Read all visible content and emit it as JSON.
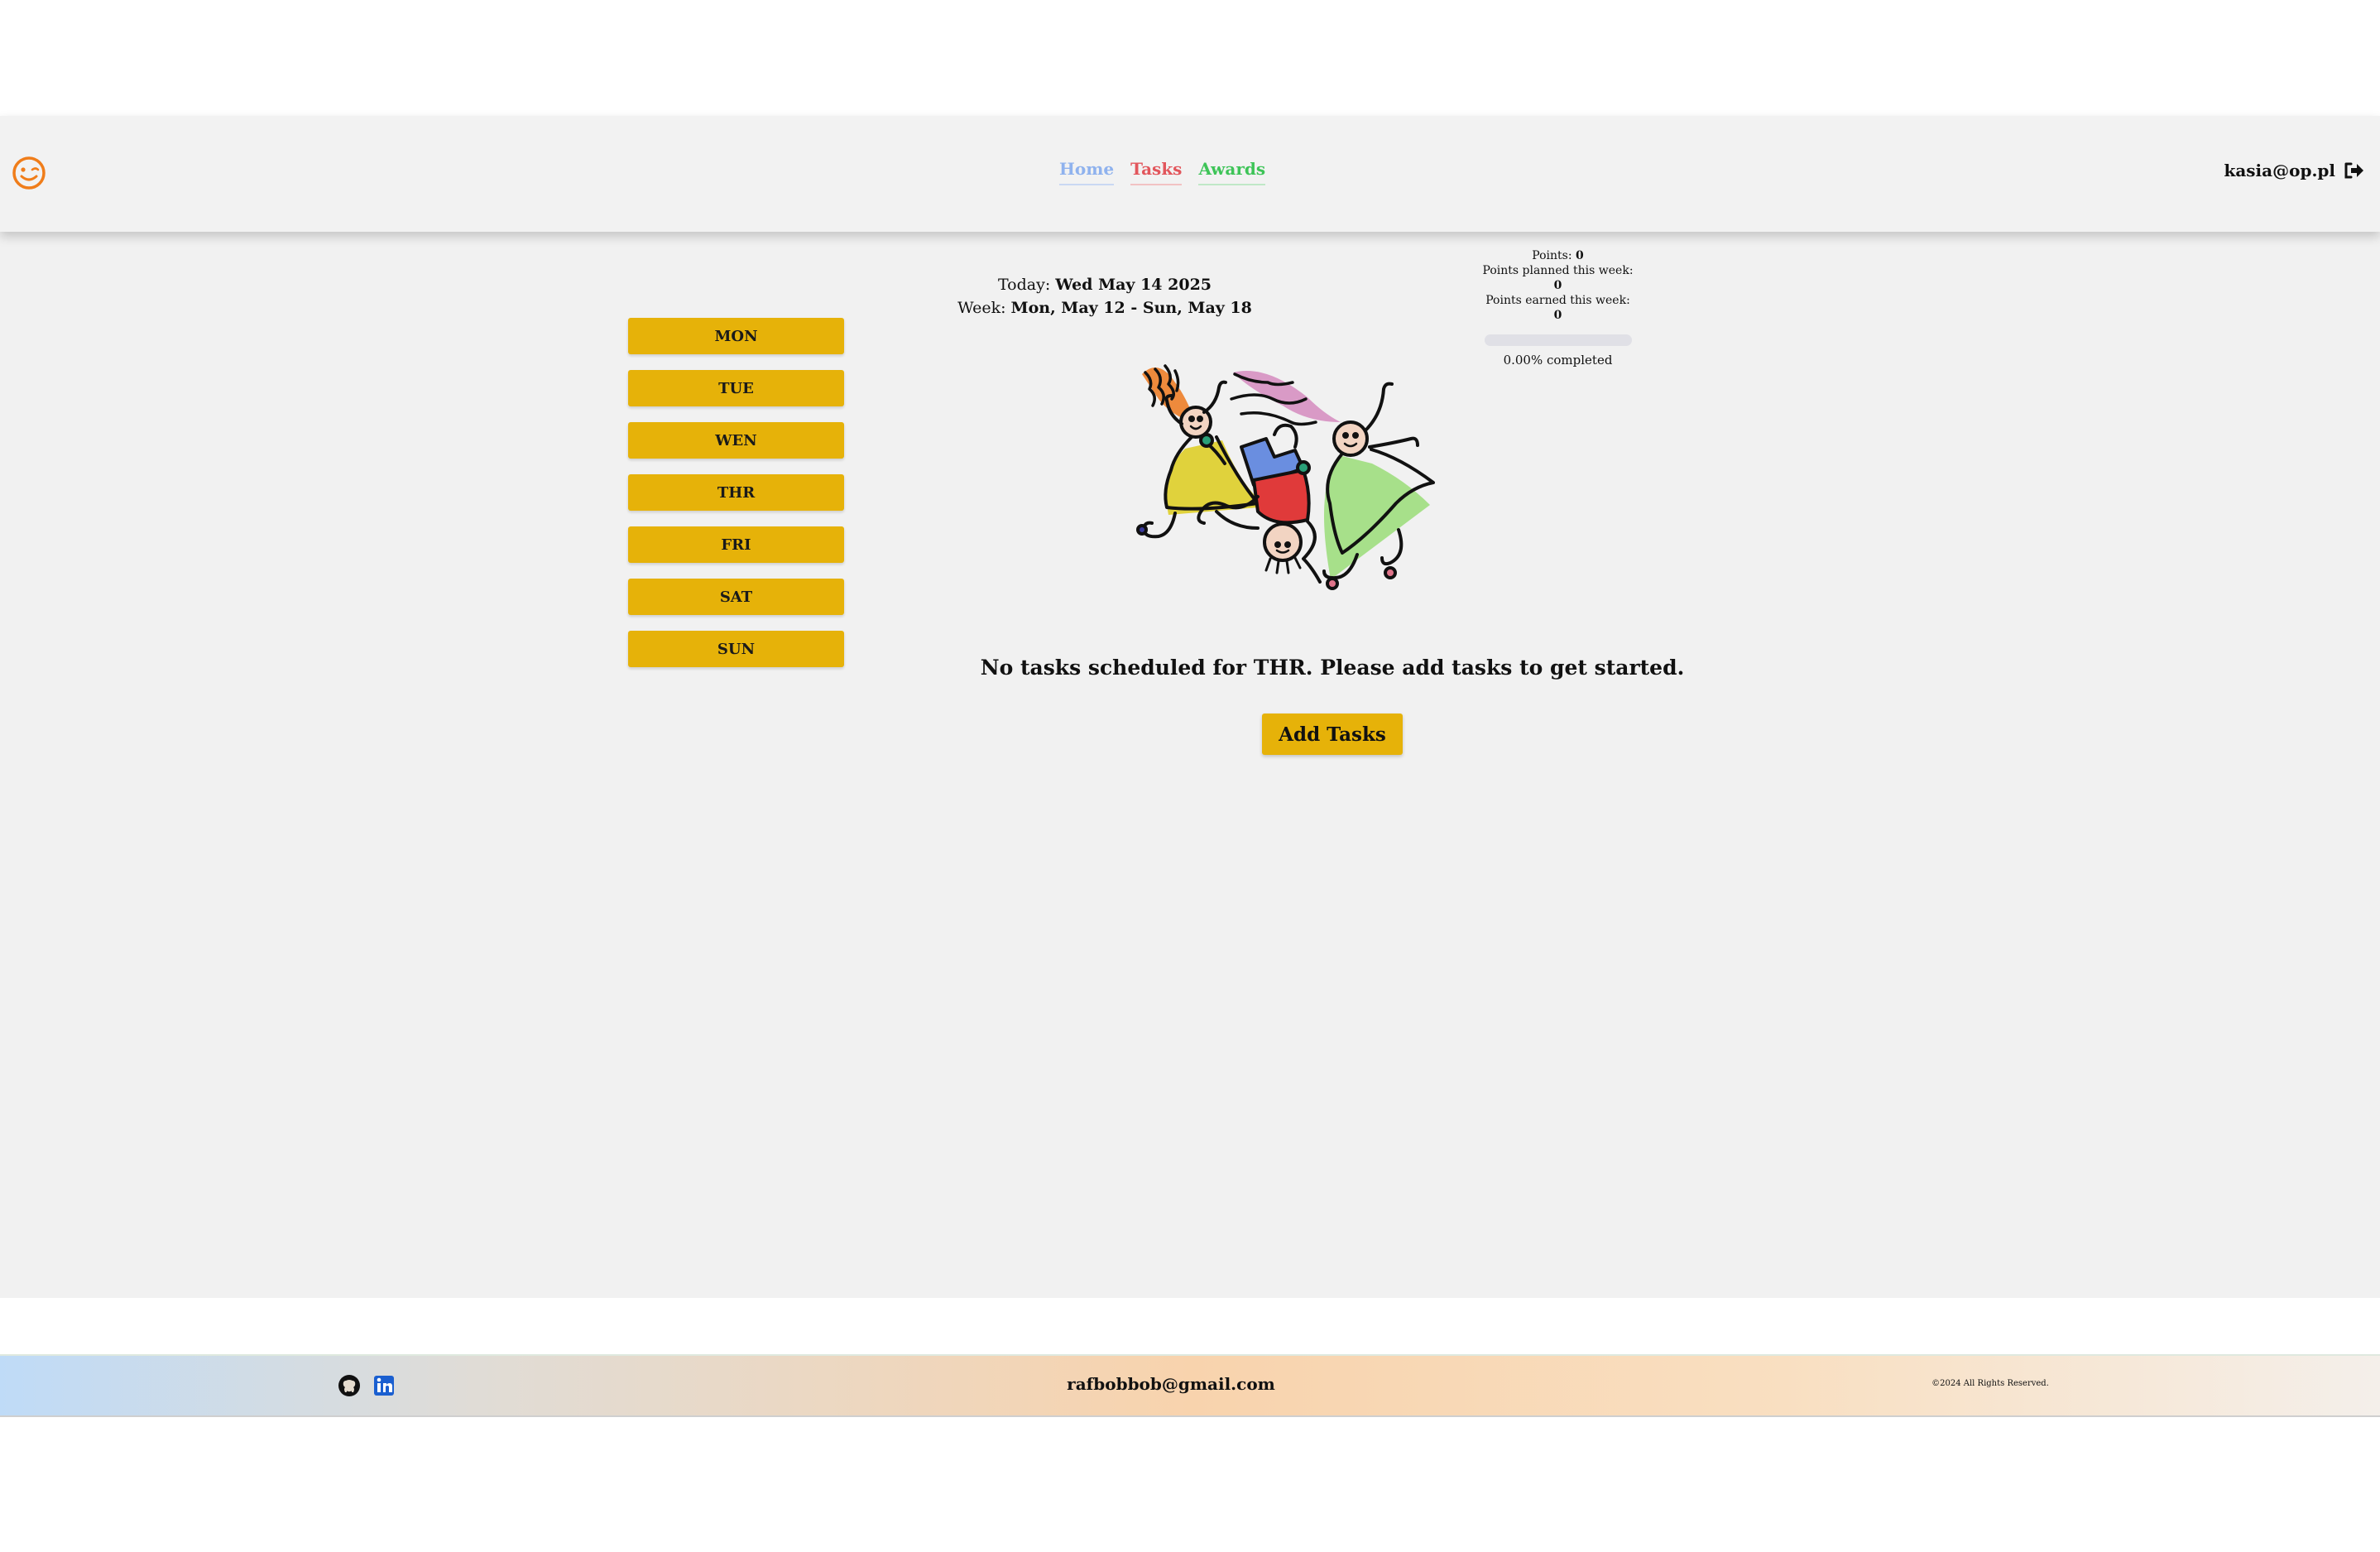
{
  "header": {
    "logo": "smile-wink-icon",
    "nav": {
      "home": "Home",
      "tasks": "Tasks",
      "awards": "Awards"
    },
    "user_email": "kasia@op.pl",
    "logout_icon": "sign-out-icon"
  },
  "days": [
    "MON",
    "TUE",
    "WEN",
    "THR",
    "FRI",
    "SAT",
    "SUN"
  ],
  "dates": {
    "today_label": "Today:",
    "today_value": "Wed May 14 2025",
    "week_label": "Week:",
    "week_value": "Mon, May 12 - Sun, May 18"
  },
  "points": {
    "points_label": "Points:",
    "points_value": "0",
    "planned_label": "Points planned this week:",
    "planned_value": "0",
    "earned_label": "Points earned this week:",
    "earned_value": "0",
    "progress_fraction": 0.0,
    "completed_text": "0.00% completed"
  },
  "main": {
    "empty_message": "No tasks scheduled for THR. Please add tasks to get started.",
    "add_button": "Add Tasks"
  },
  "footer": {
    "email": "rafbobbob@gmail.com",
    "copyright": "©2024 All Rights Reserved.",
    "icons": [
      "github-icon",
      "linkedin-icon"
    ]
  },
  "colors": {
    "accent": "#e6b209",
    "home": "#8fb2ee",
    "tasks": "#e2565c",
    "awards": "#3ec458",
    "logo": "#f07d1a"
  }
}
